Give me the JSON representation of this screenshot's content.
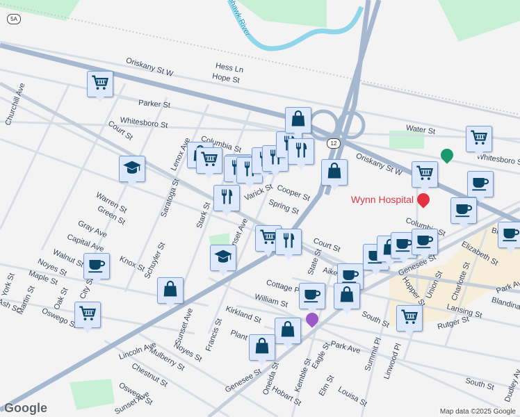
{
  "map": {
    "route_shields": [
      "5A",
      "12"
    ],
    "river_label": "Mohawk River",
    "hospital": {
      "label": "Wynn Hospital",
      "color": "#e3333f"
    },
    "streets": [
      "Oriskany St W",
      "Hess Ln",
      "Hope St",
      "Parker St",
      "Whitesboro St",
      "Court St",
      "Columbia St",
      "Lenox Ave",
      "Churchill Ave",
      "Warren St",
      "Green St",
      "Saratoga St",
      "Stark St",
      "Sunset Ave",
      "Varick St",
      "Cooper St",
      "Spring St",
      "Oriskany St W",
      "Water St",
      "Whitesboro St",
      "Columbia St",
      "Bleecker",
      "Elizabeth St",
      "Court St",
      "State St",
      "Aiken",
      "Cottage Pl",
      "William St",
      "Hopper St",
      "Union St",
      "Charlotte St",
      "Park Ave",
      "Blandina",
      "Lansing St",
      "Rutger St",
      "Genesee St",
      "South St",
      "South St",
      "Gray Ave",
      "Capital Ave",
      "Walnut St",
      "Knox St",
      "Noyes St",
      "Maple St",
      "Martin St",
      "Oak St",
      "City St",
      "Oswego St",
      "Ash St",
      "York St",
      "Schuyler St",
      "Kirkland St",
      "Plant St",
      "Francis St",
      "Sunset Ave",
      "Noyes St",
      "Mulberry St",
      "Lincoln Ave",
      "Chestnut St",
      "Oswego St",
      "Sunset Ave",
      "Genesee St",
      "Oneida St",
      "Kemble St",
      "Eagle St",
      "Elm St",
      "Hobart St",
      "Louisa St",
      "Park Ave",
      "Summit Pl",
      "Linwood Pl",
      "Dudley Av"
    ],
    "markers": [
      "cart",
      "school",
      "shopping",
      "cart",
      "shopping",
      "restaurant",
      "restaurant",
      "restaurant",
      "restaurant",
      "restaurant",
      "restaurant",
      "shopping",
      "shopping",
      "restaurant",
      "cart",
      "restaurant",
      "school",
      "coffee",
      "shopping",
      "cart",
      "coffee",
      "coffee",
      "shopping",
      "coffee",
      "shopping",
      "coffee",
      "coffee",
      "cart",
      "cart",
      "coffee",
      "coffee",
      "coffee",
      "cart",
      "shopping",
      "shopping"
    ],
    "colors": {
      "marker_bg": "#dde8fb",
      "marker_icon": "#0b4669",
      "highway": "#a6b8cf",
      "river": "#8fd6ea",
      "park": "#c8f0d7",
      "green_pin": "#1a9a6c"
    }
  },
  "footer": {
    "attribution": "Map data ©2025 Google",
    "logo": "Google"
  }
}
